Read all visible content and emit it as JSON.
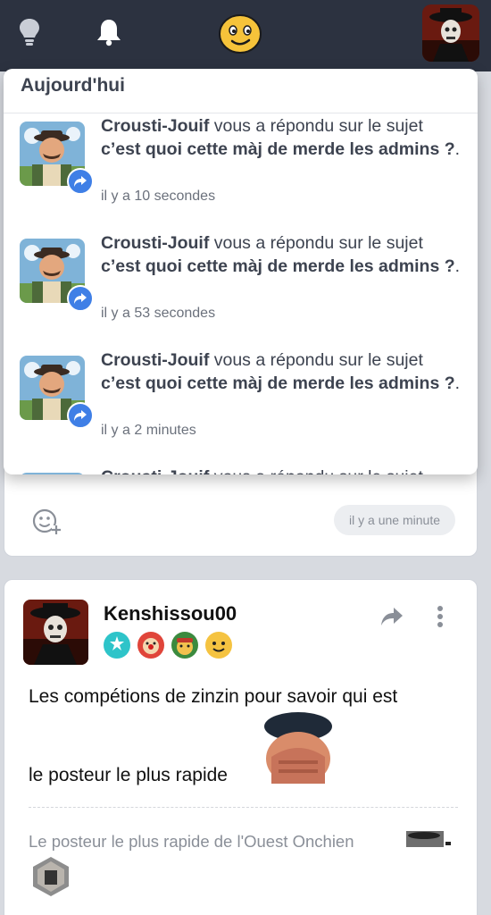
{
  "topbar": {
    "icons": [
      "lightbulb-icon",
      "bell-icon",
      "smiley-icon",
      "user-avatar"
    ],
    "background": "#2c3240"
  },
  "notifications": {
    "header": "Aujourd'hui",
    "items": [
      {
        "author": "Crousti-Jouif",
        "action": " vous a répondu sur le sujet ",
        "topic": "c’est quoi cette màj de merde les admins ?",
        "dot": ".",
        "time": "il y a 10 secondes"
      },
      {
        "author": "Crousti-Jouif",
        "action": " vous a répondu sur le sujet ",
        "topic": "c’est quoi cette màj de merde les admins ?",
        "dot": ".",
        "time": "il y a 53 secondes"
      },
      {
        "author": "Crousti-Jouif",
        "action": " vous a répondu sur le sujet ",
        "topic": "c’est quoi cette màj de merde les admins ?",
        "dot": ".",
        "time": "il y a 2 minutes"
      },
      {
        "author": "Crousti-Jouif",
        "action": " vous a répondu sur le sujet ",
        "topic": "",
        "dot": "",
        "time": ""
      }
    ],
    "badge_color": "#3f7fe6"
  },
  "prev_card": {
    "time_pill": "il y a une minute"
  },
  "post": {
    "username": "Kenshissou00",
    "body_line1": "Les compétions de zinzin pour savoir qui est",
    "body_line2": "le posteur le plus rapide",
    "signature": "Le posteur le plus rapide de l'Ouest Onchien"
  }
}
